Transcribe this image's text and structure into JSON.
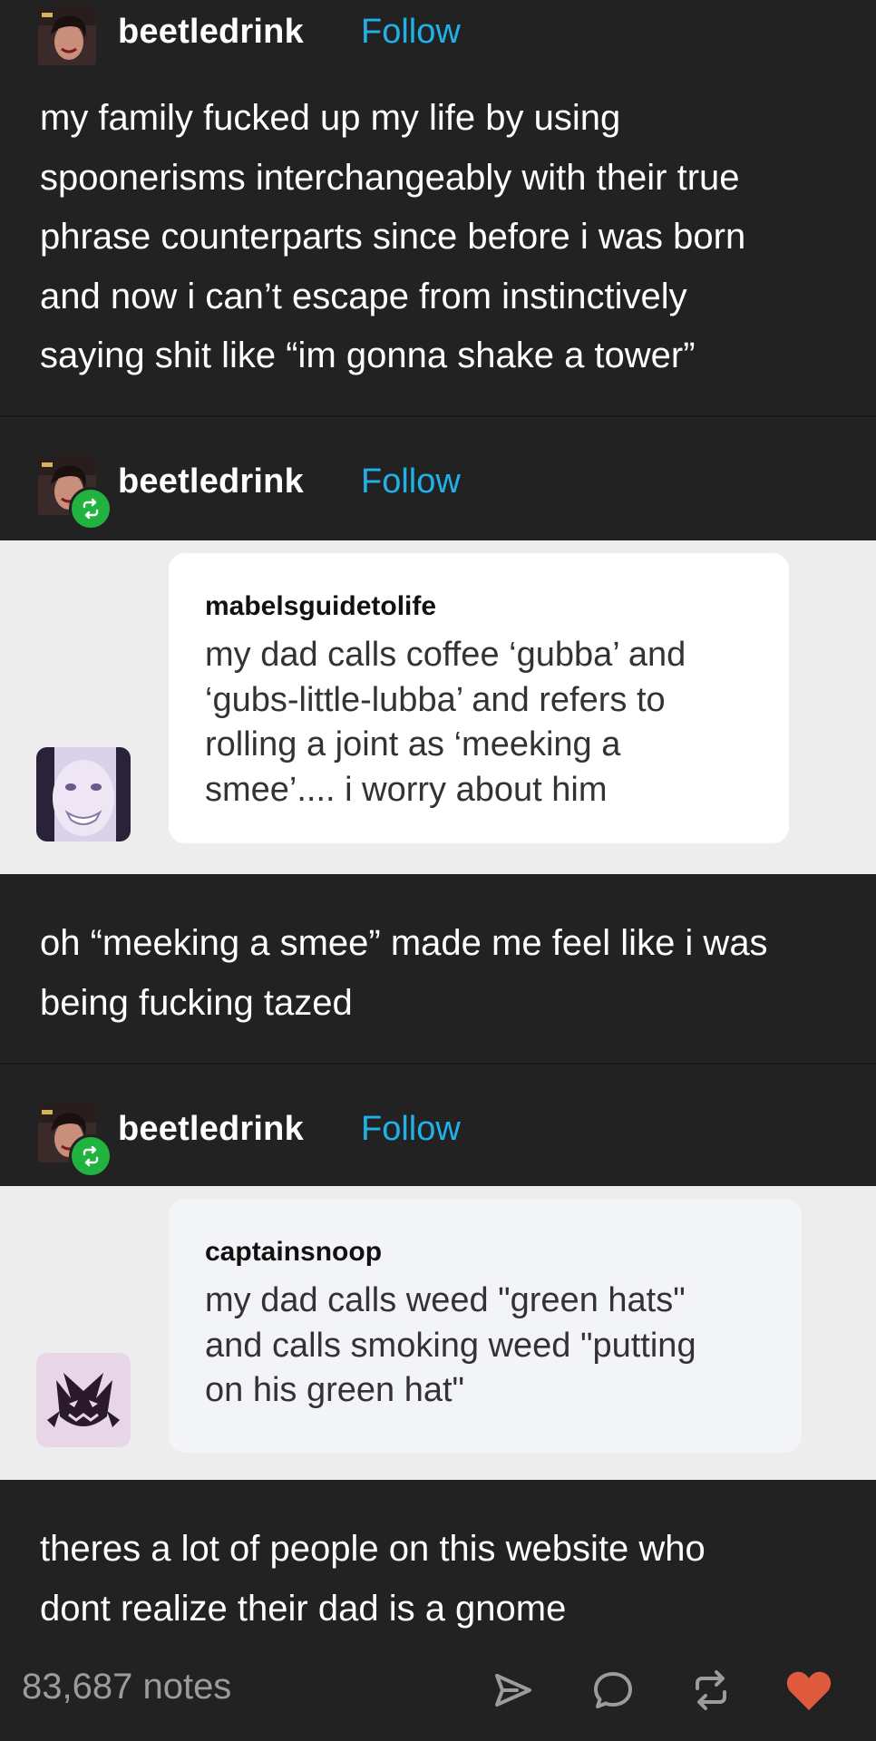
{
  "colors": {
    "background": "#222222",
    "follow": "#1fb2ea",
    "reblog_badge": "#21b33f",
    "heart": "#e05a3d",
    "light_band": "#ededed"
  },
  "posts": [
    {
      "username": "beetledrink",
      "follow_label": "Follow",
      "text_lines": [
        "my family fucked up my life by using",
        "spoonerisms interchangeably with their true",
        "phrase counterparts since before i was born",
        "and now i can’t escape from instinctively",
        "saying shit like “im gonna shake a tower”"
      ]
    },
    {
      "username": "beetledrink",
      "follow_label": "Follow",
      "reblog_icon": "reblog-icon",
      "quote": {
        "username": "mabelsguidetolife",
        "text_lines": [
          "my dad calls coffee ‘gubba’ and",
          "‘gubs-little-lubba’ and refers to",
          "rolling a joint as ‘meeking a",
          "smee’.... i worry about him"
        ]
      },
      "text_lines": [
        "oh “meeking a smee” made me feel like i was",
        "being fucking tazed"
      ]
    },
    {
      "username": "beetledrink",
      "follow_label": "Follow",
      "reblog_icon": "reblog-icon",
      "quote": {
        "username": "captainsnoop",
        "text_lines": [
          "my dad calls weed \"green hats\"",
          "and calls smoking weed \"putting",
          "on his green hat\""
        ]
      },
      "text_lines": [
        "theres a lot of people on this website who",
        "dont realize their dad is a gnome"
      ]
    }
  ],
  "footer": {
    "notes": "83,687 notes",
    "actions": [
      "share-icon",
      "reply-icon",
      "reblog-icon",
      "heart-icon"
    ]
  }
}
